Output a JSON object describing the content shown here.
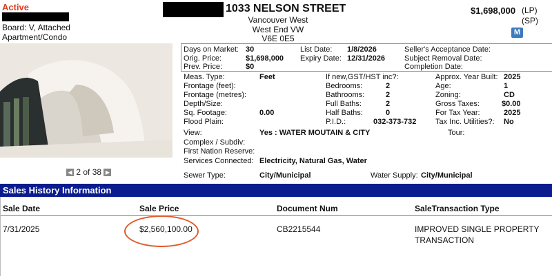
{
  "header": {
    "status": "Active",
    "board": "Board: V, Attached",
    "type": "Apartment/Condo",
    "address": "1033 NELSON STREET",
    "city": "Vancouver West",
    "area": "West End VW",
    "postal": "V6E 0E5",
    "price": "$1,698,000",
    "lp": "(LP)",
    "sp": "(SP)",
    "badge": "M"
  },
  "photo": {
    "pager": "2 of 38",
    "prev": "◀",
    "next": "▶"
  },
  "top_info": {
    "dom_label": "Days on Market:",
    "dom": "30",
    "orig_label": "Orig. Price:",
    "orig": "$1,698,000",
    "prev_label": "Prev. Price:",
    "prev": "$0",
    "list_label": "List Date:",
    "list": "1/8/2026",
    "exp_label": "Expiry Date:",
    "exp": "12/31/2026",
    "seller_label": "Seller's Acceptance Date:",
    "subject_label": "Subject Removal Date:",
    "completion_label": "Completion Date:"
  },
  "details": {
    "meas_label": "Meas. Type:",
    "meas": "Feet",
    "front_ft": "Frontage (feet):",
    "front_m": "Frontage (metres):",
    "depth": "Depth/Size:",
    "sqft_label": "Sq. Footage:",
    "sqft": "0.00",
    "flood": "Flood Plain:",
    "view_label": "View:",
    "view": "Yes : WATER MOUTAIN & CITY",
    "complex": "Complex / Subdiv:",
    "first_nation": "First Nation Reserve:",
    "services_label": "Services Connected:",
    "services": "Electricity, Natural Gas, Water",
    "gst_label": "If new,GST/HST inc?:",
    "bed_label": "Bedrooms:",
    "bed": "2",
    "bath_label": "Bathrooms:",
    "bath": "2",
    "full_label": "Full Baths:",
    "full": "2",
    "half_label": "Half Baths:",
    "half": "0",
    "pid_label": "P.I.D.:",
    "pid": "032-373-732",
    "year_label": "Approx. Year Built:",
    "year": "2025",
    "age_label": "Age:",
    "age": "1",
    "zoning_label": "Zoning:",
    "zoning": "CD",
    "tax_label": "Gross Taxes:",
    "tax": "$0.00",
    "taxyr_label": "For Tax Year:",
    "taxyr": "2025",
    "util_label": "Tax Inc. Utilities?:",
    "util": "No",
    "tour_label": "Tour:",
    "sewer_label": "Sewer Type:",
    "sewer": "City/Municipal",
    "water_label": "Water Supply:",
    "water": "City/Municipal"
  },
  "sales": {
    "title": "Sales History Information",
    "headers": [
      "Sale Date",
      "Sale Price",
      "Document Num",
      "SaleTransaction Type"
    ],
    "row": {
      "date": "7/31/2025",
      "price": "$2,560,100.00",
      "doc": "CB2215544",
      "type1": "IMPROVED SINGLE PROPERTY",
      "type2": "TRANSACTION"
    }
  },
  "colors": {
    "status": "#e33b1f",
    "band": "#0a1c8e",
    "circle": "#e2582a",
    "badge": "#3d7bbf"
  }
}
